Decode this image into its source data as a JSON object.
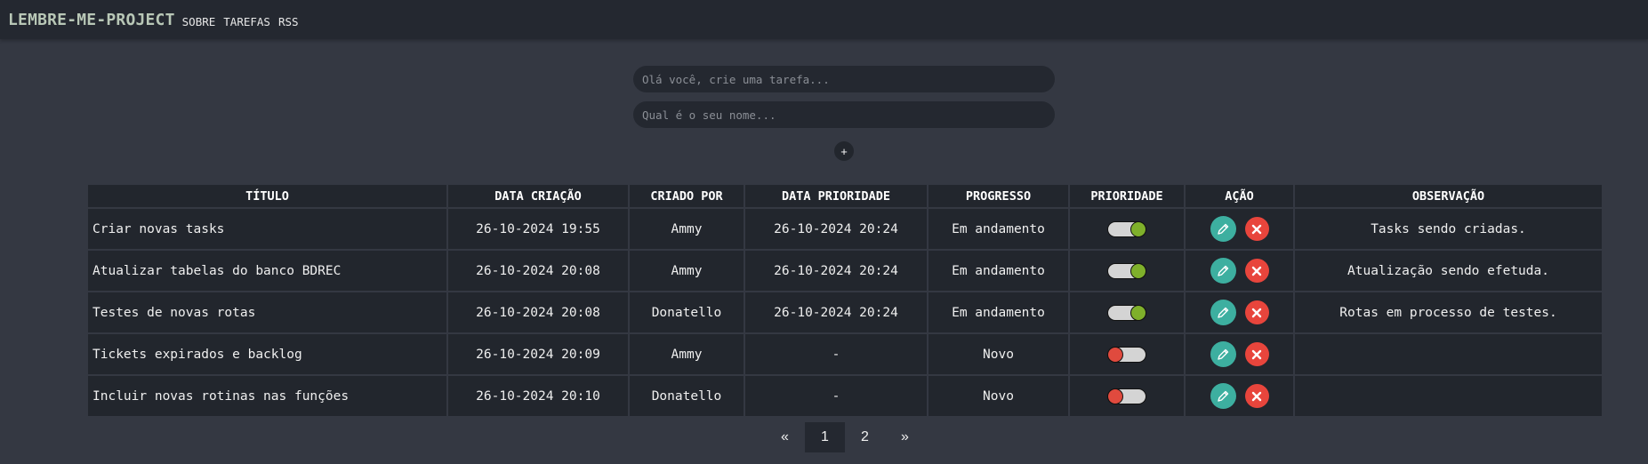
{
  "header": {
    "brand": "LEMBRE-ME-PROJECT",
    "nav": [
      "SOBRE",
      "TAREFAS",
      "RSS"
    ]
  },
  "form": {
    "task_placeholder": "Olá você, crie uma tarefa...",
    "name_placeholder": "Qual é o seu nome...",
    "add_label": "+"
  },
  "table": {
    "columns": [
      "TÍTULO",
      "DATA CRIAÇÃO",
      "CRIADO POR",
      "DATA PRIORIDADE",
      "PROGRESSO",
      "PRIORIDADE",
      "AÇÃO",
      "OBSERVAÇÃO"
    ],
    "rows": [
      {
        "title": "Criar novas tasks",
        "created": "26-10-2024 19:55",
        "author": "Ammy",
        "priority_date": "26-10-2024 20:24",
        "progress": "Em andamento",
        "priority": true,
        "note": "Tasks sendo criadas."
      },
      {
        "title": "Atualizar tabelas do banco BDREC",
        "created": "26-10-2024 20:08",
        "author": "Ammy",
        "priority_date": "26-10-2024 20:24",
        "progress": "Em andamento",
        "priority": true,
        "note": "Atualização sendo efetuda."
      },
      {
        "title": "Testes de novas rotas",
        "created": "26-10-2024 20:08",
        "author": "Donatello",
        "priority_date": "26-10-2024 20:24",
        "progress": "Em andamento",
        "priority": true,
        "note": "Rotas em processo de testes."
      },
      {
        "title": "Tickets expirados e backlog",
        "created": "26-10-2024 20:09",
        "author": "Ammy",
        "priority_date": "-",
        "progress": "Novo",
        "priority": false,
        "note": ""
      },
      {
        "title": "Incluir novas rotinas nas funções",
        "created": "26-10-2024 20:10",
        "author": "Donatello",
        "priority_date": "-",
        "progress": "Novo",
        "priority": false,
        "note": ""
      }
    ]
  },
  "pagination": {
    "prev": "«",
    "pages": [
      "1",
      "2"
    ],
    "active": "1",
    "next": "»"
  },
  "colors": {
    "edit": "#3dafa0",
    "delete": "#e8453c",
    "priority_on": "#7fb02b",
    "priority_off": "#e04a3e"
  }
}
